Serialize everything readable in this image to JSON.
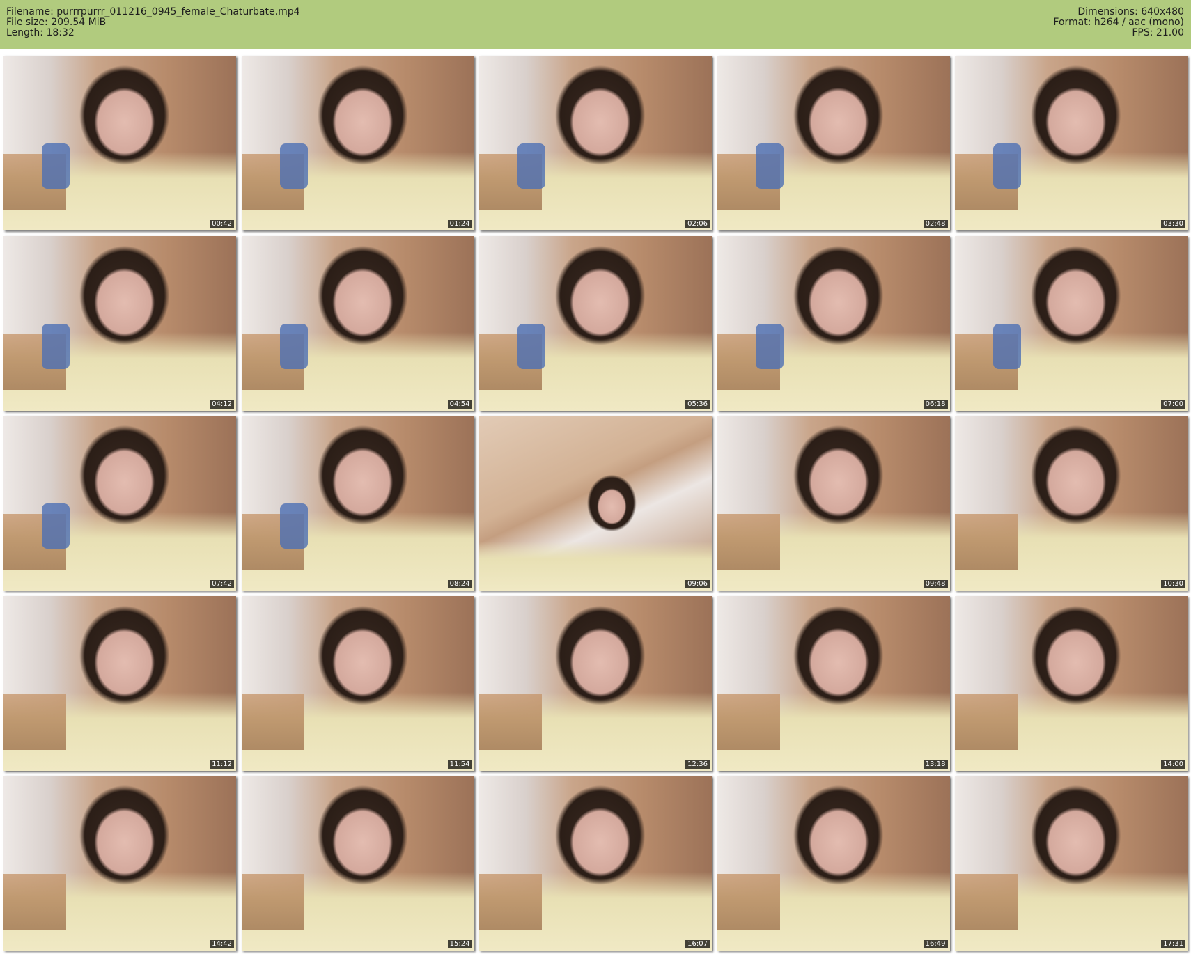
{
  "info": {
    "filename": "Filename: purrrpurrr_011216_0945_female_Chaturbate.mp4",
    "file_size": "File size: 209.54 MiB",
    "length": "Length: 18:32",
    "dimensions": "Dimensions: 640x480",
    "format": "Format: h264 / aac (mono)",
    "fps": "FPS: 21.00"
  },
  "thumbnails": [
    {
      "time": "00:42"
    },
    {
      "time": "01:24"
    },
    {
      "time": "02:06"
    },
    {
      "time": "02:48"
    },
    {
      "time": "03:30"
    },
    {
      "time": "04:12"
    },
    {
      "time": "04:54"
    },
    {
      "time": "05:36"
    },
    {
      "time": "06:18"
    },
    {
      "time": "07:00"
    },
    {
      "time": "07:42"
    },
    {
      "time": "08:24"
    },
    {
      "time": "09:06"
    },
    {
      "time": "09:48"
    },
    {
      "time": "10:30"
    },
    {
      "time": "11:12"
    },
    {
      "time": "11:54"
    },
    {
      "time": "12:36"
    },
    {
      "time": "13:18"
    },
    {
      "time": "14:00"
    },
    {
      "time": "14:42"
    },
    {
      "time": "15:24"
    },
    {
      "time": "16:07"
    },
    {
      "time": "16:49"
    },
    {
      "time": "17:31"
    }
  ],
  "colors": {
    "header_background": "#b1cb7e",
    "header_text": "#1e1e1e",
    "timestamp_background": "#000000",
    "timestamp_text": "#ffffff"
  }
}
